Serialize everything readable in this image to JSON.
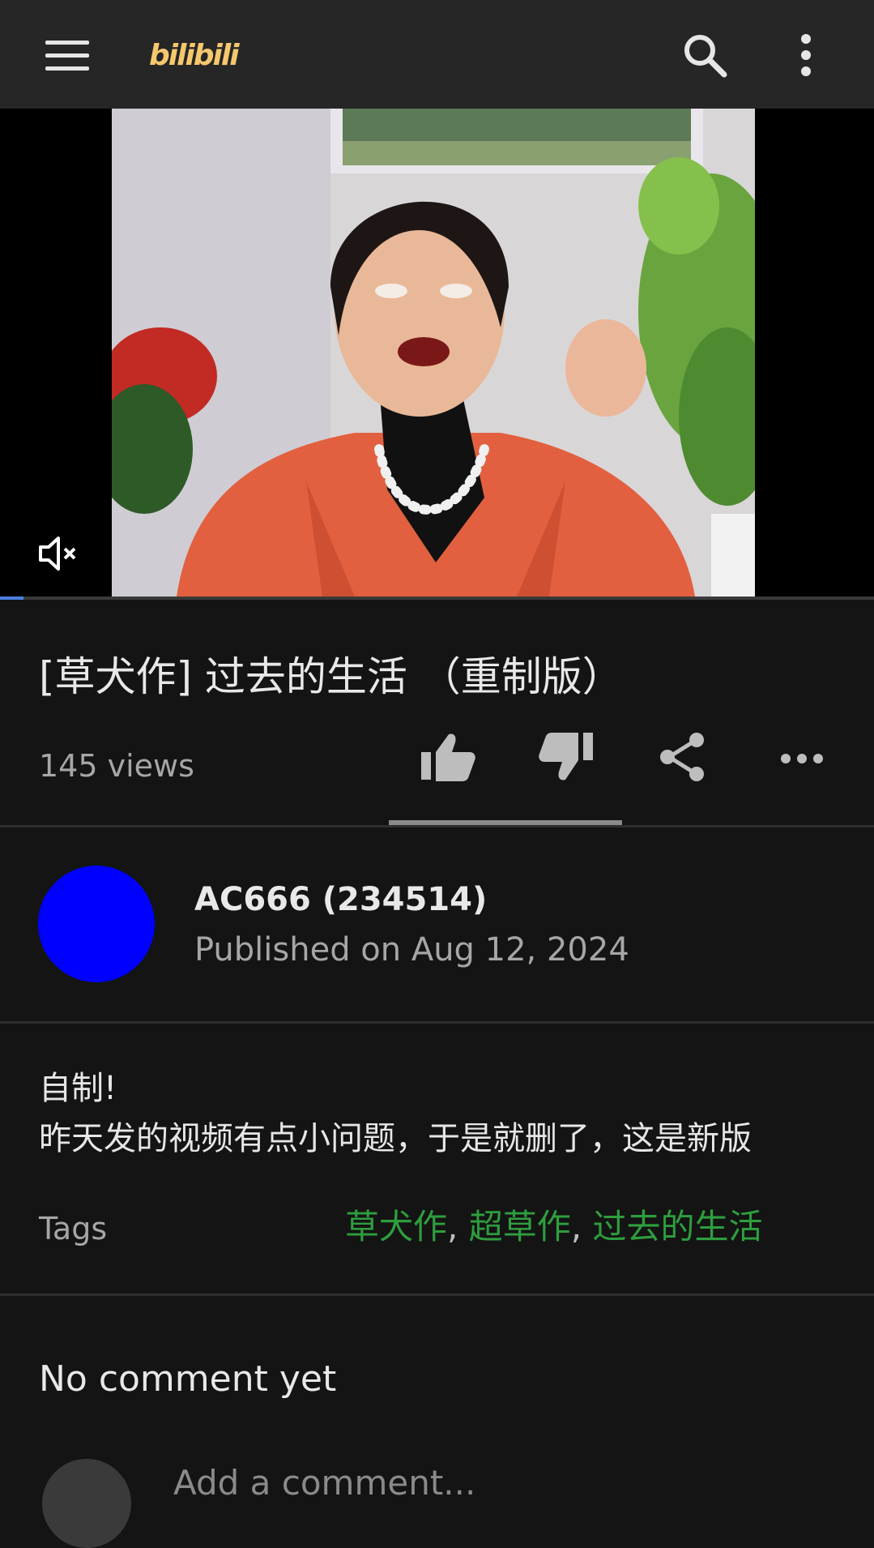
{
  "header": {
    "logo_text": "bilibili",
    "menu_icon": "menu-icon",
    "search_icon": "search-icon",
    "more_icon": "more-vert-icon"
  },
  "player": {
    "progress_fraction": 0.027,
    "mute_icon": "volume-muted-icon"
  },
  "video": {
    "title": "[草犬作] 过去的生活 （重制版）",
    "views": "145 views",
    "actions": [
      "like",
      "dislike",
      "share",
      "more"
    ]
  },
  "uploader": {
    "name": "AC666 (234514)",
    "published": "Published on Aug 12, 2024",
    "avatar_color": "#0000ff"
  },
  "description": {
    "line1": "自制!",
    "line2": "昨天发的视频有点小问题，于是就删了，这是新版"
  },
  "tags": {
    "label": "Tags",
    "items": [
      "草犬作",
      "超草作",
      "过去的生活"
    ],
    "color": "#2e9e3e"
  },
  "comments": {
    "empty_text": "No comment yet",
    "input_placeholder": "Add a comment..."
  }
}
